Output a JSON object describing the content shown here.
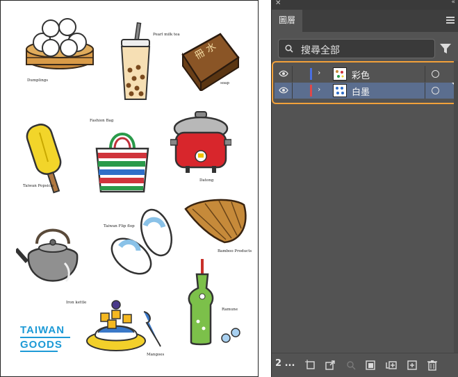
{
  "artboard": {
    "labels": {
      "dumplings": "Dumplings",
      "pearl_milk_tea": "Pearl milk tea",
      "soap": "soap",
      "fashion_bag": "Fashion Bag",
      "taiwan_popsicle": "Taiwan Popsicle",
      "datong": "Datong",
      "flip_flop": "Taiwan Flip flop",
      "bamboo": "Bamboo Products",
      "iron_kettle": "Iron kettle",
      "ramune": "Ramune",
      "mangoes": "Mangoes"
    },
    "brand_line1": "TAIWAN",
    "brand_line2": "GOODS",
    "soap_text": "冊 水"
  },
  "panel": {
    "close_glyph": "✕",
    "collapse_glyph": "«",
    "tab_label": "圖層",
    "search_label": "搜尋全部",
    "layers": [
      {
        "name": "彩色",
        "bar_color": "#4a6fe0",
        "selected": false
      },
      {
        "name": "白墨",
        "bar_color": "#e04848",
        "selected": true
      }
    ],
    "layer_count": "2 ...",
    "accent": "#f2a13a"
  }
}
